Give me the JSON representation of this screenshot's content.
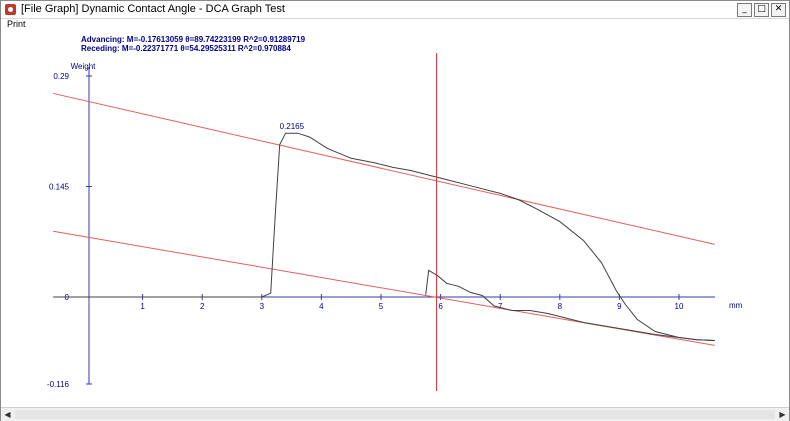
{
  "window": {
    "title": "[File Graph] Dynamic Contact Angle - DCA Graph Test",
    "minimize_glyph": "_",
    "maximize_glyph": "□",
    "close_glyph": "✕"
  },
  "menu": {
    "print_label": "Print"
  },
  "fit_lines": {
    "advancing": "Advancing:  M=-0.17613059  θ=89.74223199  R^2=0.91289719",
    "receding": "Receding:  M=-0.22371771  θ=54.29525311  R^2=0.970884"
  },
  "scroll": {
    "left_glyph": "◀",
    "right_glyph": "▶"
  },
  "colors": {
    "axis": "#3a3aa8",
    "curve": "#404040",
    "fit": "#e06060",
    "cursor": "#d03030",
    "label": "#00008b"
  },
  "chart_data": {
    "type": "line",
    "ylabel": "Weight",
    "xlabel": "mm",
    "y_ticks": [
      "0.29",
      "0.145",
      "0",
      "-0.116"
    ],
    "y_tick_values": [
      0.29,
      0.145,
      0,
      -0.116
    ],
    "x_ticks": [
      "1",
      "2",
      "3",
      "4",
      "5",
      "6",
      "7",
      "8",
      "9",
      "10"
    ],
    "x_tick_values": [
      1,
      2,
      3,
      4,
      5,
      6,
      7,
      8,
      9,
      10
    ],
    "xlim": [
      -0.5,
      10.6
    ],
    "ylim": [
      -0.116,
      0.29
    ],
    "peak_label": "0.2165",
    "peak_point": [
      3.5,
      0.2165
    ],
    "cursor_x": 6,
    "advancing_curve": [
      [
        -0.5,
        0
      ],
      [
        3.0,
        0
      ],
      [
        3.15,
        0.005
      ],
      [
        3.22,
        0.1
      ],
      [
        3.3,
        0.2
      ],
      [
        3.4,
        0.215
      ],
      [
        3.6,
        0.215
      ],
      [
        3.8,
        0.21
      ],
      [
        4.1,
        0.195
      ],
      [
        4.5,
        0.182
      ],
      [
        4.9,
        0.176
      ],
      [
        5.2,
        0.17
      ],
      [
        5.5,
        0.166
      ],
      [
        5.8,
        0.16
      ],
      [
        6.1,
        0.154
      ],
      [
        6.4,
        0.148
      ],
      [
        6.7,
        0.142
      ],
      [
        7.0,
        0.136
      ],
      [
        7.3,
        0.128
      ],
      [
        7.6,
        0.116
      ],
      [
        8.0,
        0.099
      ],
      [
        8.4,
        0.074
      ],
      [
        8.7,
        0.045
      ],
      [
        8.95,
        0.008
      ],
      [
        9.1,
        -0.01
      ],
      [
        9.3,
        -0.03
      ],
      [
        9.6,
        -0.046
      ],
      [
        10.0,
        -0.054
      ],
      [
        10.3,
        -0.057
      ],
      [
        10.6,
        -0.058
      ]
    ],
    "receding_curve": [
      [
        5.75,
        0.003
      ],
      [
        5.8,
        0.035
      ],
      [
        5.95,
        0.028
      ],
      [
        6.1,
        0.018
      ],
      [
        6.3,
        0.014
      ],
      [
        6.5,
        0.006
      ],
      [
        6.7,
        0.002
      ],
      [
        6.9,
        -0.012
      ],
      [
        7.2,
        -0.018
      ],
      [
        7.5,
        -0.018
      ],
      [
        7.8,
        -0.022
      ],
      [
        8.1,
        -0.028
      ],
      [
        8.4,
        -0.034
      ],
      [
        8.7,
        -0.038
      ],
      [
        9.0,
        -0.042
      ],
      [
        9.3,
        -0.046
      ],
      [
        9.6,
        -0.05
      ],
      [
        10.0,
        -0.054
      ],
      [
        10.3,
        -0.057
      ],
      [
        10.6,
        -0.058
      ]
    ],
    "advancing_fit": {
      "slope": -0.01784,
      "intercept": 0.2582,
      "x_range": [
        -0.5,
        10.6
      ]
    },
    "receding_fit": {
      "slope": -0.01358,
      "intercept": 0.0795,
      "x_range": [
        -0.5,
        10.6
      ]
    }
  }
}
